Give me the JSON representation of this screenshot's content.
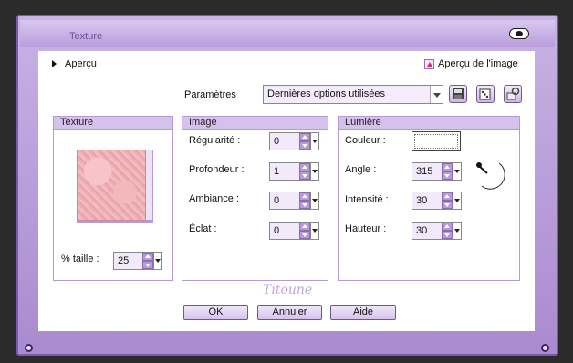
{
  "window": {
    "title": "Texture"
  },
  "header": {
    "apercu_label": "Aperçu",
    "apercu_image_label": "Aperçu de l'image",
    "parametres_label": "Paramètres",
    "preset_value": "Dernières options utilisées"
  },
  "texture_panel": {
    "heading": "Texture",
    "taille_label": "% taille :",
    "taille_value": "25"
  },
  "image_panel": {
    "heading": "Image",
    "fields": [
      {
        "label": "Régularité :",
        "value": "0"
      },
      {
        "label": "Profondeur :",
        "value": "1"
      },
      {
        "label": "Ambiance :",
        "value": "0"
      },
      {
        "label": "Éclat :",
        "value": "0"
      }
    ]
  },
  "light_panel": {
    "heading": "Lumière",
    "couleur_label": "Couleur :",
    "fields": [
      {
        "label": "Angle :",
        "value": "315"
      },
      {
        "label": "Intensité :",
        "value": "30"
      },
      {
        "label": "Hauteur :",
        "value": "30"
      }
    ]
  },
  "watermark": "Titoune",
  "buttons": {
    "ok": "OK",
    "cancel": "Annuler",
    "help": "Aide"
  },
  "colors": {
    "accent": "#b99ddc",
    "frame": "#7b59ac",
    "heading_bg": "#d5c2ec"
  }
}
